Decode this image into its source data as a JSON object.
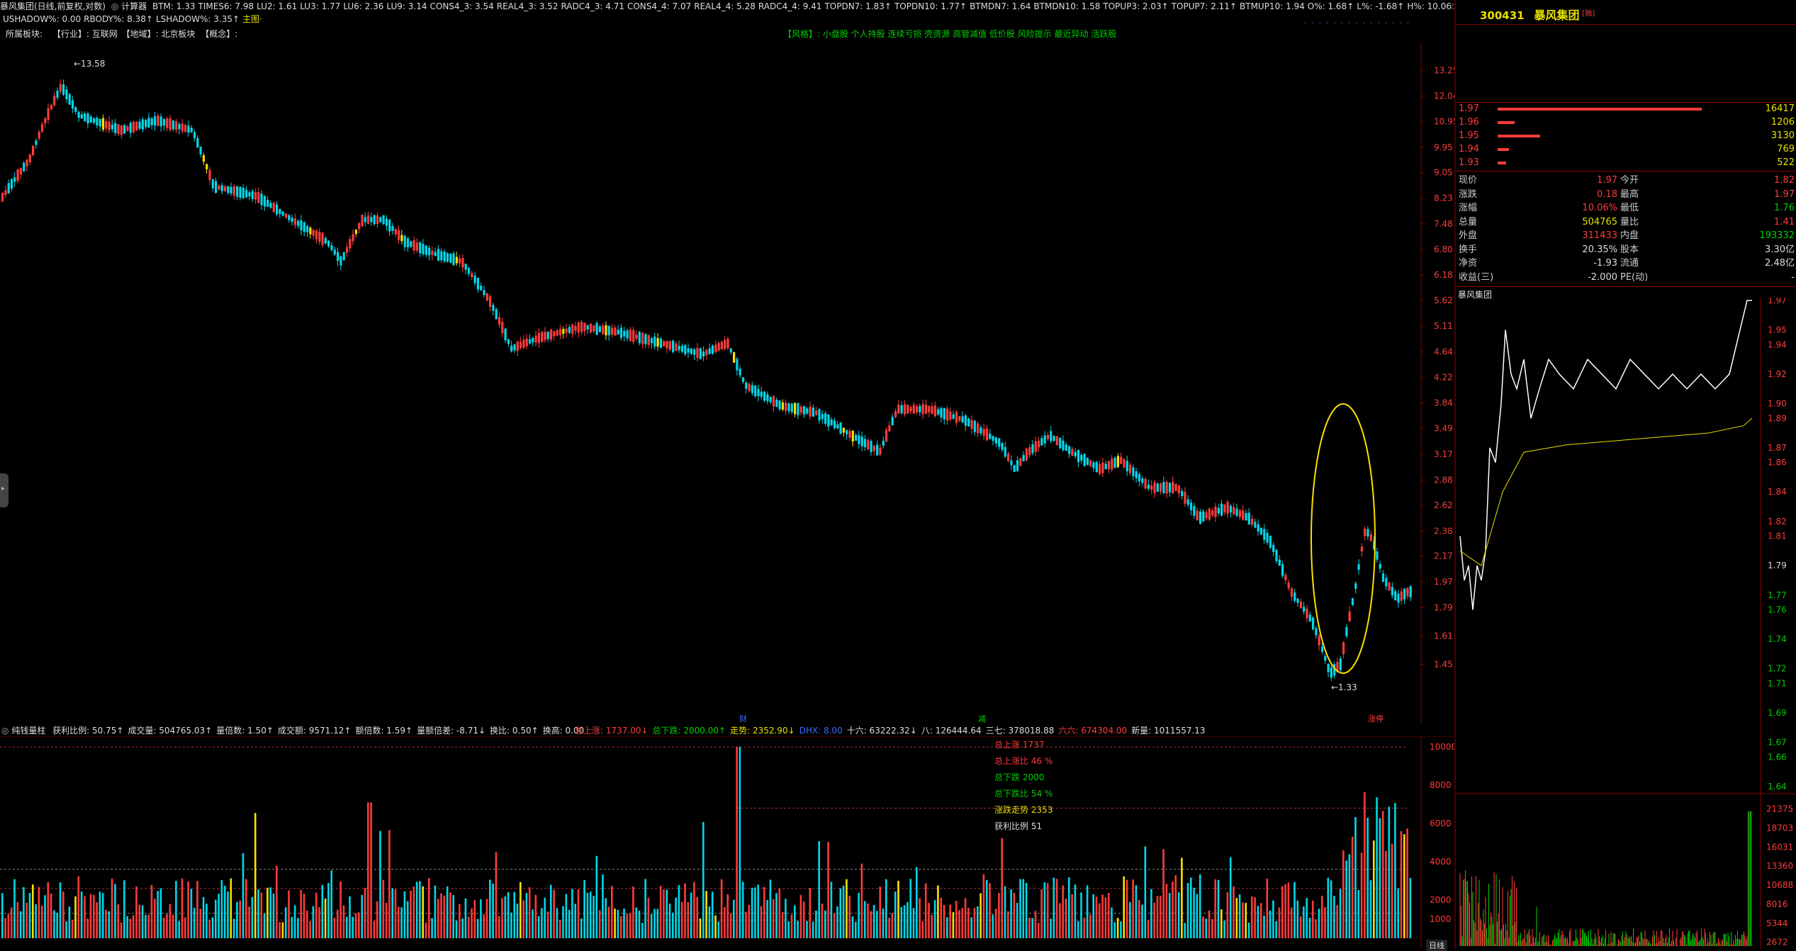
{
  "window": {
    "title": "暴风集团(日线,前复权,对数)",
    "calc_label": "计算器"
  },
  "top_params": [
    {
      "t": "BTM: 1.33",
      "c": "wh"
    },
    {
      "t": "TIMES6: 7.98",
      "c": "wh"
    },
    {
      "t": "LU2: 1.61",
      "c": "wh"
    },
    {
      "t": "LU3: 1.77",
      "c": "wh"
    },
    {
      "t": "LU6: 2.36",
      "c": "wh"
    },
    {
      "t": "LU9: 3.14",
      "c": "wh"
    },
    {
      "t": "CONS4_3: 3.54",
      "c": "wh"
    },
    {
      "t": "REAL4_3: 3.52",
      "c": "wh"
    },
    {
      "t": "RADC4_3: 4.71",
      "c": "wh"
    },
    {
      "t": "CONS4_4: 7.07",
      "c": "wh"
    },
    {
      "t": "REAL4_4: 5.28",
      "c": "wh"
    },
    {
      "t": "RADC4_4: 9.41",
      "c": "wh"
    },
    {
      "t": "TOPDN7: 1.83↑",
      "c": "wh"
    },
    {
      "t": "TOPDN10: 1.77↑",
      "c": "wh"
    },
    {
      "t": "BTMDN7: 1.64",
      "c": "wh"
    },
    {
      "t": "BTMDN10: 1.58",
      "c": "wh"
    },
    {
      "t": "TOPUP3: 2.03↑",
      "c": "wh"
    },
    {
      "t": "TOPUP7: 2.11↑",
      "c": "wh"
    },
    {
      "t": "BTMUP10: 1.94",
      "c": "wh"
    },
    {
      "t": "O%: 1.68↑",
      "c": "wh"
    },
    {
      "t": "L%: -1.68↑",
      "c": "wh"
    },
    {
      "t": "H%: 10.06↑",
      "c": "wh"
    }
  ],
  "top_params2": [
    {
      "t": "USHADOW%: 0.00",
      "c": "wh"
    },
    {
      "t": "RBODY%: 8.38↑",
      "c": "wh"
    },
    {
      "t": "LSHADOW%: 3.35↑",
      "c": "wh"
    },
    {
      "t": "主图·",
      "c": "yl"
    }
  ],
  "sector": {
    "label": "所属板块:",
    "industry": "【行业】: 互联网",
    "region": "【地域】: 北京板块",
    "concept": "【概念】:"
  },
  "tagline": "【风格】: 小盘股 个人持股 连续亏损 壳资源 高管减值 低价股 风险提示 最近异动 活跃股",
  "price_axis": {
    "labels": [
      "13.25",
      "12.04",
      "10.95",
      "9.95",
      "9.05",
      "8.23",
      "7.48",
      "6.80",
      "6.18",
      "5.62",
      "5.11",
      "4.64",
      "4.22",
      "3.84",
      "3.49",
      "3.17",
      "2.88",
      "2.62",
      "2.38",
      "2.17",
      "1.97",
      "1.79",
      "1.61",
      "1.45"
    ]
  },
  "main_chart": {
    "high_label": "13.58",
    "low_label": "1.33",
    "marker_cai": "财",
    "marker_jian": "减",
    "marker_zhangting": "涨停"
  },
  "volume_indicator": {
    "name": "纯钱量柱",
    "params": [
      {
        "t": "获利比例: 50.75↑",
        "c": "wh"
      },
      {
        "t": "成交量: 504765.03↑",
        "c": "wh"
      },
      {
        "t": "量倍数: 1.50↑",
        "c": "wh"
      },
      {
        "t": "成交额: 9571.12↑",
        "c": "wh"
      },
      {
        "t": "额倍数: 1.59↑",
        "c": "wh"
      },
      {
        "t": "量额倍差: -8.71↓",
        "c": "wh"
      },
      {
        "t": "换比: 0.50↑",
        "c": "wh"
      },
      {
        "t": "换高: 0.00",
        "c": "wh"
      }
    ],
    "params_right": [
      {
        "t": "总上涨: 1737.00↓",
        "c": "up"
      },
      {
        "t": "总下跌: 2000.00↑",
        "c": "dn"
      },
      {
        "t": "走势: 2352.90↓",
        "c": "yl"
      },
      {
        "t": "DHX: 8.00",
        "c": "bl"
      },
      {
        "t": "十六: 63222.32↓",
        "c": "wh"
      },
      {
        "t": "八: 126444.64",
        "c": "wh"
      },
      {
        "t": "三七: 378018.88",
        "c": "wh"
      },
      {
        "t": "六六: 674304.00",
        "c": "up"
      },
      {
        "t": "新量: 1011557.13",
        "c": "wh"
      }
    ],
    "stats": [
      {
        "t": "总上涨 1737",
        "c": "up"
      },
      {
        "t": "总上涨比 46 %",
        "c": "up"
      },
      {
        "t": "总下跌 2000",
        "c": "dn"
      },
      {
        "t": "总下跌比 54 %",
        "c": "dn"
      },
      {
        "t": "涨跌走势 2353",
        "c": "yl"
      },
      {
        "t": "获利比例 51",
        "c": "wh"
      }
    ],
    "axis": [
      "10000",
      "8000",
      "6000",
      "4000",
      "2000",
      "1000"
    ],
    "bottom_tab": "日线"
  },
  "right": {
    "code": "300431",
    "name": "暴风集团",
    "badge": "[融]",
    "orderbook": [
      {
        "price": "1.97",
        "vol": "16417",
        "w": 0.72
      },
      {
        "price": "1.96",
        "vol": "1206",
        "w": 0.06
      },
      {
        "price": "1.95",
        "vol": "3130",
        "w": 0.15
      },
      {
        "price": "1.94",
        "vol": "769",
        "w": 0.04
      },
      {
        "price": "1.93",
        "vol": "522",
        "w": 0.03
      }
    ],
    "quotes": [
      {
        "l": "现价",
        "v": "1.97",
        "vc": "up",
        "l2": "今开",
        "v2": "1.82",
        "v2c": "up"
      },
      {
        "l": "涨跌",
        "v": "0.18",
        "vc": "up",
        "l2": "最高",
        "v2": "1.97",
        "v2c": "up"
      },
      {
        "l": "涨幅",
        "v": "10.06%",
        "vc": "up",
        "l2": "最低",
        "v2": "1.76",
        "v2c": "dn"
      },
      {
        "l": "总量",
        "v": "504765",
        "vc": "yl",
        "l2": "量比",
        "v2": "1.41",
        "v2c": "up"
      },
      {
        "l": "外盘",
        "v": "311433",
        "vc": "up",
        "l2": "内盘",
        "v2": "193332",
        "v2c": "dn"
      },
      {
        "l": "换手",
        "v": "20.35%",
        "vc": "wh",
        "l2": "股本",
        "v2": "3.30亿",
        "v2c": "wh"
      },
      {
        "l": "净资",
        "v": "-1.93",
        "vc": "wh",
        "l2": "流通",
        "v2": "2.48亿",
        "v2c": "wh"
      },
      {
        "l": "收益(三)",
        "v": "-2.000",
        "vc": "wh",
        "l2": "PE(动)",
        "v2": "-",
        "v2c": "wh"
      }
    ],
    "intraday_title": "暴风集团",
    "intraday_axis": [
      "1.97",
      "1.95",
      "1.94",
      "1.92",
      "1.90",
      "1.89",
      "1.87",
      "1.86",
      "1.84",
      "1.82",
      "1.81",
      "1.79",
      "1.77",
      "1.76",
      "1.74",
      "1.72",
      "1.71",
      "1.69",
      "1.67",
      "1.66",
      "1.64"
    ],
    "intraday_vol_axis": [
      "21375",
      "18703",
      "16031",
      "13360",
      "10688",
      "8016",
      "5344",
      "2672"
    ]
  },
  "colors": {
    "up": "#ff3b3b",
    "down": "#00d8e8",
    "yellow": "#ffe000",
    "grid": "#4a0000",
    "axis": "#8b0000"
  }
}
